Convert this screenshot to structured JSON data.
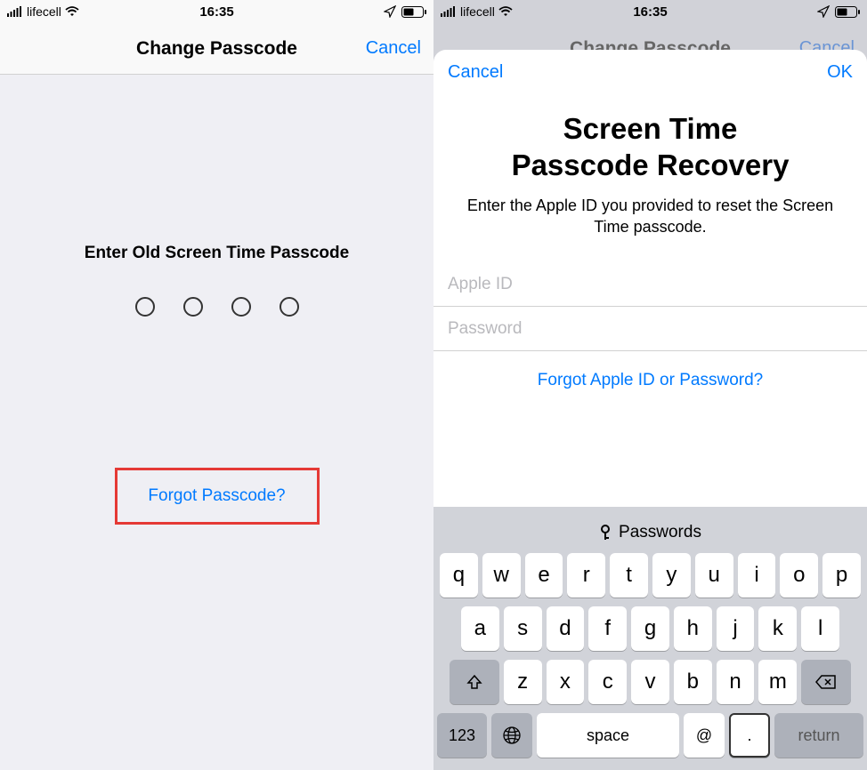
{
  "statusbar": {
    "carrier": "lifecell",
    "time": "16:35"
  },
  "left": {
    "nav_title": "Change Passcode",
    "nav_cancel": "Cancel",
    "prompt": "Enter Old Screen Time Passcode",
    "forgot": "Forgot Passcode?"
  },
  "right": {
    "nav_title": "Change Passcode",
    "nav_cancel": "Cancel",
    "modal_cancel": "Cancel",
    "modal_ok": "OK",
    "modal_title_line1": "Screen Time",
    "modal_title_line2": "Passcode Recovery",
    "modal_desc": "Enter the Apple ID you provided to reset the Screen Time passcode.",
    "field_appleid_placeholder": "Apple ID",
    "field_password_placeholder": "Password",
    "forgot_apple": "Forgot Apple ID or Password?"
  },
  "keyboard": {
    "toolbar_label": "Passwords",
    "row1": [
      "q",
      "w",
      "e",
      "r",
      "t",
      "y",
      "u",
      "i",
      "o",
      "p"
    ],
    "row2": [
      "a",
      "s",
      "d",
      "f",
      "g",
      "h",
      "j",
      "k",
      "l"
    ],
    "row3": [
      "z",
      "x",
      "c",
      "v",
      "b",
      "n",
      "m"
    ],
    "k123": "123",
    "space": "space",
    "at": "@",
    "dot": ".",
    "return": "return"
  }
}
